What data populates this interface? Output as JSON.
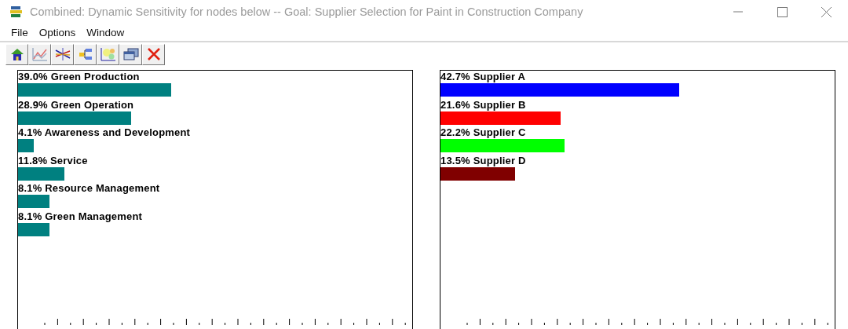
{
  "window": {
    "title": "Combined: Dynamic Sensitivity for nodes below -- Goal: Supplier Selection for Paint in Construction Company"
  },
  "menu": [
    "File",
    "Options",
    "Window"
  ],
  "toolbar": [
    {
      "kind": "home"
    },
    {
      "kind": "graph"
    },
    {
      "kind": "lines"
    },
    {
      "kind": "tree"
    },
    {
      "kind": "diagram"
    },
    {
      "kind": "windows"
    },
    {
      "kind": "close"
    }
  ],
  "panels": [
    {
      "bars": [
        {
          "label": "39.0% Green Production",
          "level": 0.388,
          "color": "#008080"
        },
        {
          "label": "28.9% Green Operation",
          "level": 0.287,
          "color": "#008080"
        },
        {
          "label": "4.1% Awareness and Development",
          "level": 0.04,
          "color": "#008080"
        },
        {
          "label": "11.8% Service",
          "level": 0.117,
          "color": "#008080"
        },
        {
          "label": "8.1% Resource Management",
          "level": 0.08,
          "color": "#008080"
        },
        {
          "label": "8.1% Green Management",
          "level": 0.08,
          "color": "#008080"
        }
      ]
    },
    {
      "bars": [
        {
          "label": "42.7% Supplier A",
          "level": 0.605,
          "color": "#0000ff"
        },
        {
          "label": "21.6% Supplier B",
          "level": 0.305,
          "color": "#ff0000"
        },
        {
          "label": "22.2% Supplier C",
          "level": 0.314,
          "color": "#00ff00"
        },
        {
          "label": "13.5% Supplier D",
          "level": 0.19,
          "color": "#800000"
        }
      ]
    }
  ]
}
